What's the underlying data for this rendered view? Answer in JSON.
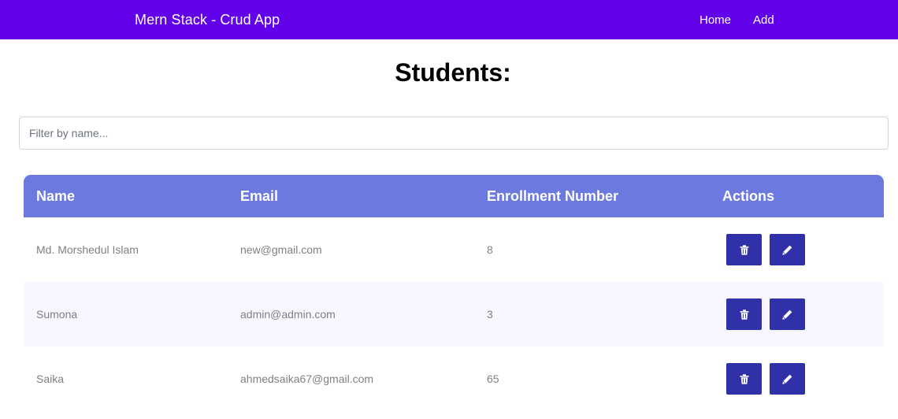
{
  "navbar": {
    "brand": "Mern Stack - Crud App",
    "links": [
      {
        "label": "Home"
      },
      {
        "label": "Add"
      }
    ]
  },
  "page": {
    "title": "Students:"
  },
  "filter": {
    "placeholder": "Filter by name..."
  },
  "table": {
    "headers": [
      "Name",
      "Email",
      "Enrollment Number",
      "Actions"
    ],
    "rows": [
      {
        "name": "Md. Morshedul Islam",
        "email": "new@gmail.com",
        "enrollment": "8"
      },
      {
        "name": "Sumona",
        "email": "admin@admin.com",
        "enrollment": "3"
      },
      {
        "name": "Saika",
        "email": "ahmedsaika67@gmail.com",
        "enrollment": "65"
      }
    ],
    "row_actions": [
      "trash-icon",
      "pencil-icon"
    ]
  },
  "colors": {
    "navbar": "#6200ea",
    "table_header": "#6c7ae0",
    "action_button": "#3030a8",
    "row_alt": "#f8f6ff"
  }
}
